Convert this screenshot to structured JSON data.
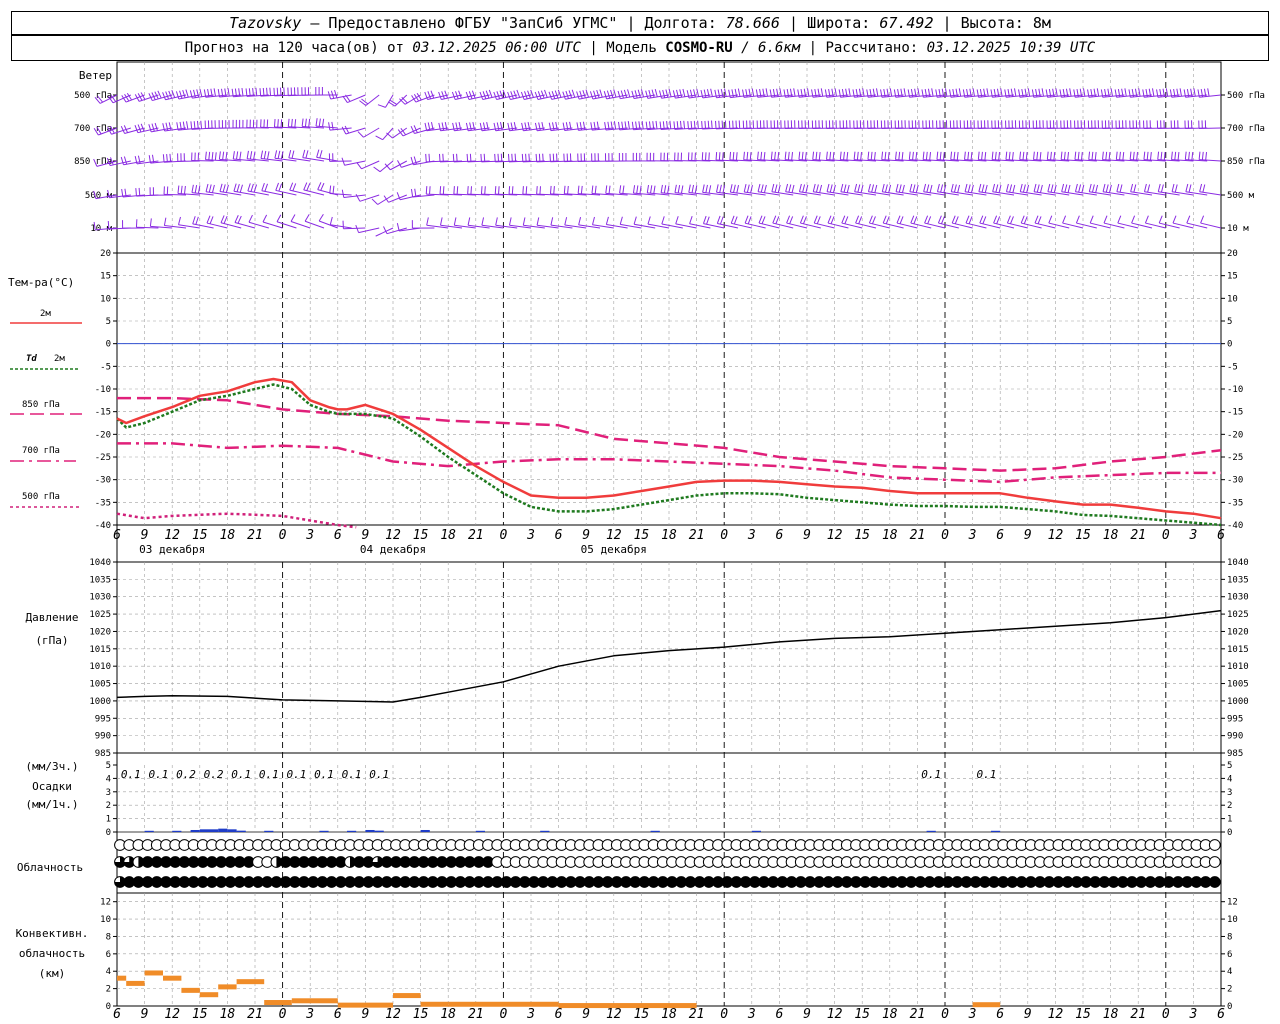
{
  "header": {
    "station": "Tazovsky",
    "provider": "— Предоставлено ФГБУ \"ЗапСиб УГМС\"",
    "lon_label": "Долгота:",
    "lon_value": "78.666",
    "lat_label": "Широта:",
    "lat_value": "67.492",
    "alt_label": "Высота:",
    "alt_value": "8м",
    "forecast_text": "Прогноз на 120 часа(ов) от",
    "init_time": "03.12.2025 06:00 UTC",
    "model_label": "Модель",
    "model_name": "COSMO-RU",
    "model_res": "/ 6.6км",
    "calc_label": "Рассчитано:",
    "calc_time": "03.12.2025 10:39 UTC"
  },
  "labels": {
    "wind": "Ветер",
    "wind_levels": [
      "500 гПа",
      "700 гПа",
      "850 гПа",
      "500 м",
      "10  м"
    ],
    "temp_title": "Тем-ра(°С)",
    "t2m": "2м",
    "td2m_a": "Td",
    "td2m_b": "2м",
    "t850": "850 гПа",
    "t700": "700 гПа",
    "t500": "500 гПа",
    "pres_title": "Давление",
    "pres_unit": "(гПа)",
    "precip_unit_top": "(мм/3ч.)",
    "precip_title": "Осадки",
    "precip_unit_bot": "(мм/1ч.)",
    "cloud_title": "Облачность",
    "conv_title_1": "Конвективн.",
    "conv_title_2": "облачность",
    "conv_unit": "(км)"
  },
  "colors": {
    "wind": "#8a2be2",
    "t2m": "#f03c3c",
    "td2m": "#1f7a1f",
    "t850": "#e0207a",
    "t700": "#e0207a",
    "t500": "#d0207a",
    "zero": "#3050d0",
    "pressure": "#000000",
    "precip": "#1e3cc8",
    "conv": "#f08c28",
    "grid": "#a0a0a0"
  },
  "chart_data": {
    "type": "line",
    "x_hours": [
      0,
      3,
      6,
      9,
      12,
      15,
      18,
      21,
      24,
      27,
      30,
      33,
      36,
      39,
      42,
      45,
      48,
      51,
      54,
      57,
      60,
      63,
      66,
      69,
      72,
      75,
      78,
      81,
      84,
      87,
      90,
      93,
      96,
      99,
      102,
      105,
      108,
      111,
      114,
      117,
      120,
      123,
      126
    ],
    "x_tick_labels": [
      "6",
      "9",
      "12",
      "15",
      "18",
      "21",
      "0",
      "3",
      "6",
      "9",
      "12",
      "15",
      "18",
      "21",
      "0",
      "3",
      "6",
      "9",
      "12",
      "15",
      "18",
      "21",
      "0",
      "3",
      "6",
      "9",
      "12"
    ],
    "day_labels": [
      "03 декабря",
      "04 декабря",
      "05 декабря"
    ],
    "day_label_hours": [
      6,
      30,
      54
    ],
    "temperature": {
      "ylim": [
        -40,
        20
      ],
      "yticks": [
        20,
        15,
        10,
        5,
        0,
        -5,
        -10,
        -15,
        -20,
        -25,
        -30,
        -35,
        -40
      ],
      "t2m": [
        [
          0,
          -16.5
        ],
        [
          1,
          -17.5
        ],
        [
          3,
          -16
        ],
        [
          6,
          -14
        ],
        [
          9,
          -11.5
        ],
        [
          12,
          -10.5
        ],
        [
          15,
          -8.5
        ],
        [
          17,
          -7.8
        ],
        [
          19,
          -8.5
        ],
        [
          21,
          -12.5
        ],
        [
          23,
          -14
        ],
        [
          24,
          -14.5
        ],
        [
          25,
          -14.5
        ],
        [
          27,
          -13.5
        ],
        [
          30,
          -15.5
        ],
        [
          33,
          -19
        ],
        [
          36,
          -23
        ],
        [
          39,
          -27
        ],
        [
          42,
          -30.5
        ],
        [
          45,
          -33.5
        ],
        [
          48,
          -34
        ],
        [
          51,
          -34
        ],
        [
          54,
          -33.5
        ],
        [
          57,
          -32.5
        ],
        [
          60,
          -31.5
        ],
        [
          63,
          -30.5
        ],
        [
          66,
          -30.2
        ],
        [
          69,
          -30.2
        ],
        [
          72,
          -30.5
        ],
        [
          75,
          -31
        ],
        [
          78,
          -31.5
        ],
        [
          81,
          -31.8
        ],
        [
          84,
          -32.5
        ],
        [
          87,
          -33
        ],
        [
          90,
          -33
        ],
        [
          93,
          -33
        ],
        [
          96,
          -33
        ],
        [
          99,
          -34
        ],
        [
          102,
          -34.8
        ],
        [
          105,
          -35.5
        ],
        [
          108,
          -35.5
        ],
        [
          111,
          -36.2
        ],
        [
          114,
          -37
        ],
        [
          117,
          -37.5
        ],
        [
          120,
          -38.5
        ]
      ],
      "td2m": [
        [
          0,
          -16.5
        ],
        [
          1,
          -18.5
        ],
        [
          3,
          -17.5
        ],
        [
          6,
          -15
        ],
        [
          9,
          -12.5
        ],
        [
          12,
          -11.5
        ],
        [
          15,
          -10
        ],
        [
          17,
          -9
        ],
        [
          19,
          -10
        ],
        [
          21,
          -13.5
        ],
        [
          23,
          -15
        ],
        [
          24,
          -15.5
        ],
        [
          27,
          -15.5
        ],
        [
          30,
          -16.5
        ],
        [
          33,
          -20.5
        ],
        [
          36,
          -25
        ],
        [
          39,
          -29
        ],
        [
          42,
          -33
        ],
        [
          45,
          -36
        ],
        [
          48,
          -37
        ],
        [
          51,
          -37
        ],
        [
          54,
          -36.5
        ],
        [
          57,
          -35.5
        ],
        [
          60,
          -34.5
        ],
        [
          63,
          -33.5
        ],
        [
          66,
          -33
        ],
        [
          69,
          -33
        ],
        [
          72,
          -33.2
        ],
        [
          75,
          -34
        ],
        [
          78,
          -34.5
        ],
        [
          81,
          -35
        ],
        [
          84,
          -35.5
        ],
        [
          87,
          -35.8
        ],
        [
          90,
          -35.8
        ],
        [
          93,
          -36
        ],
        [
          96,
          -36
        ],
        [
          99,
          -36.5
        ],
        [
          102,
          -37
        ],
        [
          105,
          -37.8
        ],
        [
          108,
          -38
        ],
        [
          111,
          -38.5
        ],
        [
          114,
          -39
        ],
        [
          117,
          -39.5
        ],
        [
          120,
          -40
        ]
      ],
      "t850": [
        [
          0,
          -12
        ],
        [
          6,
          -12
        ],
        [
          12,
          -12.5
        ],
        [
          18,
          -14.5
        ],
        [
          24,
          -15.5
        ],
        [
          30,
          -16
        ],
        [
          36,
          -17
        ],
        [
          42,
          -17.5
        ],
        [
          48,
          -18
        ],
        [
          54,
          -21
        ],
        [
          60,
          -22
        ],
        [
          66,
          -23
        ],
        [
          72,
          -25
        ],
        [
          78,
          -26
        ],
        [
          84,
          -27
        ],
        [
          90,
          -27.5
        ],
        [
          96,
          -28
        ],
        [
          102,
          -27.5
        ],
        [
          108,
          -26
        ],
        [
          114,
          -25
        ],
        [
          120,
          -23.5
        ]
      ],
      "t700": [
        [
          0,
          -22
        ],
        [
          6,
          -22
        ],
        [
          12,
          -23
        ],
        [
          18,
          -22.5
        ],
        [
          24,
          -23
        ],
        [
          30,
          -26
        ],
        [
          36,
          -27
        ],
        [
          42,
          -26
        ],
        [
          48,
          -25.5
        ],
        [
          54,
          -25.5
        ],
        [
          60,
          -26
        ],
        [
          66,
          -26.5
        ],
        [
          72,
          -27
        ],
        [
          78,
          -28
        ],
        [
          84,
          -29.5
        ],
        [
          90,
          -30
        ],
        [
          96,
          -30.5
        ],
        [
          102,
          -29.5
        ],
        [
          108,
          -29
        ],
        [
          114,
          -28.5
        ],
        [
          120,
          -28.5
        ]
      ],
      "t500": [
        [
          0,
          -37.5
        ],
        [
          3,
          -38.5
        ],
        [
          6,
          -38
        ],
        [
          12,
          -37.5
        ],
        [
          18,
          -38
        ],
        [
          21,
          -39
        ],
        [
          24,
          -40
        ],
        [
          26,
          -40.5
        ]
      ]
    },
    "pressure": {
      "ylim": [
        985,
        1040
      ],
      "yticks": [
        1040,
        1035,
        1030,
        1025,
        1020,
        1015,
        1010,
        1005,
        1000,
        995,
        990,
        985
      ],
      "values": [
        [
          0,
          1001
        ],
        [
          3,
          1001.3
        ],
        [
          6,
          1001.5
        ],
        [
          12,
          1001.3
        ],
        [
          18,
          1000.3
        ],
        [
          24,
          1000
        ],
        [
          30,
          999.7
        ],
        [
          33,
          1001
        ],
        [
          36,
          1002.5
        ],
        [
          42,
          1005.5
        ],
        [
          48,
          1010
        ],
        [
          54,
          1013
        ],
        [
          60,
          1014.5
        ],
        [
          66,
          1015.5
        ],
        [
          72,
          1017
        ],
        [
          78,
          1018
        ],
        [
          84,
          1018.5
        ],
        [
          90,
          1019.5
        ],
        [
          96,
          1020.5
        ],
        [
          102,
          1021.5
        ],
        [
          108,
          1022.5
        ],
        [
          114,
          1024
        ],
        [
          120,
          1026
        ]
      ]
    },
    "precipitation": {
      "ylim": [
        0,
        5
      ],
      "yticks": [
        5,
        4,
        3,
        2,
        1,
        0
      ],
      "totals_3h": [
        "0.1",
        "0.1",
        "0.2",
        "0.2",
        "0.1",
        "0.1",
        "0.1",
        "0.1",
        "0.1",
        "0.1",
        "0.1",
        "0.1"
      ],
      "totals_3h_hours": [
        1.5,
        4.5,
        7.5,
        10.5,
        13.5,
        16.5,
        19.5,
        22.5,
        25.5,
        28.5,
        88.5,
        94.5
      ],
      "hourly": [
        [
          3,
          0.05
        ],
        [
          6,
          0.05
        ],
        [
          8,
          0.15
        ],
        [
          9,
          0.2
        ],
        [
          10,
          0.2
        ],
        [
          11,
          0.25
        ],
        [
          12,
          0.2
        ],
        [
          13,
          0.1
        ],
        [
          16,
          0.05
        ],
        [
          22,
          0.05
        ],
        [
          25,
          0.05
        ],
        [
          27,
          0.15
        ],
        [
          28,
          0.1
        ],
        [
          33,
          0.15
        ],
        [
          39,
          0.05
        ],
        [
          46,
          0.05
        ],
        [
          58,
          0.05
        ],
        [
          69,
          0.05
        ],
        [
          88,
          0.05
        ],
        [
          95,
          0.05
        ]
      ]
    },
    "cloudiness": {
      "scale": "oktas",
      "rows": [
        [
          0,
          0,
          0,
          0,
          0,
          0,
          0,
          0,
          0,
          0,
          0,
          0,
          0,
          0,
          0,
          0,
          0,
          0,
          0,
          0,
          0,
          0,
          0,
          0,
          0,
          0,
          0,
          0,
          0,
          0,
          0,
          0,
          0,
          0,
          0,
          0,
          0,
          0,
          0,
          0,
          0,
          0,
          0,
          0,
          0,
          0,
          0,
          0,
          0,
          0,
          0,
          0,
          0,
          0,
          0,
          0,
          0,
          0,
          0,
          0,
          0,
          0,
          0,
          0,
          0,
          0,
          0,
          0,
          0,
          0,
          0,
          0,
          0,
          0,
          0,
          0,
          0,
          0,
          0,
          0,
          0,
          0,
          0,
          0,
          0,
          0,
          0,
          0,
          0,
          0,
          0,
          0,
          0,
          0,
          0,
          0,
          0,
          0,
          0,
          0,
          0,
          0,
          0,
          0,
          0,
          0,
          0,
          0,
          0,
          0,
          0,
          0,
          0,
          0,
          0,
          0,
          0,
          0,
          0,
          0,
          0
        ],
        [
          6,
          6,
          4,
          8,
          8,
          8,
          8,
          8,
          8,
          8,
          8,
          8,
          8,
          8,
          8,
          0,
          0,
          4,
          8,
          8,
          8,
          8,
          8,
          8,
          8,
          4,
          8,
          8,
          6,
          8,
          8,
          8,
          8,
          8,
          8,
          8,
          8,
          8,
          8,
          8,
          8,
          0,
          0,
          0,
          0,
          0,
          0,
          0,
          0,
          0,
          0,
          0,
          0,
          0,
          0,
          0,
          0,
          0,
          0,
          0,
          0,
          0,
          0,
          0,
          0,
          0,
          0,
          0,
          0,
          0,
          0,
          0,
          0,
          0,
          0,
          0,
          0,
          0,
          0,
          0,
          0,
          0,
          0,
          0,
          0,
          0,
          0,
          0,
          0,
          0,
          0,
          0,
          0,
          0,
          0,
          0,
          0,
          0,
          0,
          0,
          0,
          0,
          0,
          0,
          0,
          0,
          0,
          0,
          0,
          0,
          0,
          0,
          0,
          0,
          0,
          0,
          0,
          0,
          0,
          0,
          0
        ],
        [
          6,
          8,
          8,
          8,
          8,
          8,
          8,
          8,
          8,
          8,
          8,
          8,
          8,
          8,
          8,
          8,
          8,
          8,
          8,
          8,
          8,
          8,
          8,
          8,
          8,
          8,
          8,
          8,
          8,
          8,
          8,
          8,
          8,
          8,
          8,
          8,
          8,
          8,
          8,
          8,
          8,
          8,
          8,
          8,
          8,
          8,
          8,
          8,
          8,
          8,
          8,
          8,
          8,
          8,
          8,
          8,
          8,
          8,
          8,
          8,
          8,
          8,
          8,
          8,
          8,
          8,
          8,
          8,
          8,
          8,
          8,
          8,
          8,
          8,
          8,
          8,
          8,
          8,
          8,
          8,
          8,
          8,
          8,
          8,
          8,
          8,
          8,
          8,
          8,
          8,
          8,
          8,
          8,
          8,
          8,
          8,
          8,
          8,
          8,
          8,
          8,
          8,
          8,
          8,
          8,
          8,
          8,
          8,
          8,
          8,
          8,
          8,
          8,
          8,
          8,
          8,
          8,
          8,
          8,
          8,
          8
        ]
      ]
    },
    "convective": {
      "ylim": [
        0,
        13
      ],
      "yticks": [
        12,
        10,
        8,
        6,
        4,
        2,
        0
      ],
      "segments": [
        [
          0,
          1,
          3.2
        ],
        [
          1,
          3,
          2.6
        ],
        [
          3,
          5,
          3.8
        ],
        [
          5,
          7,
          3.2
        ],
        [
          7,
          9,
          1.8
        ],
        [
          9,
          11,
          1.3
        ],
        [
          11,
          13,
          2.2
        ],
        [
          13,
          16,
          2.8
        ],
        [
          16,
          19,
          0.4
        ],
        [
          19,
          24,
          0.6
        ],
        [
          24,
          30,
          0.1
        ],
        [
          30,
          33,
          1.2
        ],
        [
          33,
          36,
          0.2
        ],
        [
          36,
          48,
          0.2
        ],
        [
          48,
          63,
          0.05
        ],
        [
          93,
          96,
          0.15
        ]
      ]
    },
    "wind": {
      "levels": [
        "500 гПа",
        "700 гПа",
        "850 гПа",
        "500 м",
        "10  м"
      ],
      "approx_direction_deg": [
        [
          0,
          230
        ],
        [
          12,
          260
        ],
        [
          24,
          270
        ],
        [
          30,
          200
        ],
        [
          36,
          250
        ],
        [
          48,
          250
        ],
        [
          72,
          260
        ],
        [
          96,
          260
        ],
        [
          120,
          260
        ]
      ],
      "approx_speed_ms": [
        [
          0,
          10
        ],
        [
          12,
          25
        ],
        [
          24,
          15
        ],
        [
          30,
          6
        ],
        [
          36,
          15
        ],
        [
          48,
          20
        ],
        [
          72,
          22
        ],
        [
          96,
          22
        ],
        [
          120,
          20
        ]
      ]
    }
  }
}
